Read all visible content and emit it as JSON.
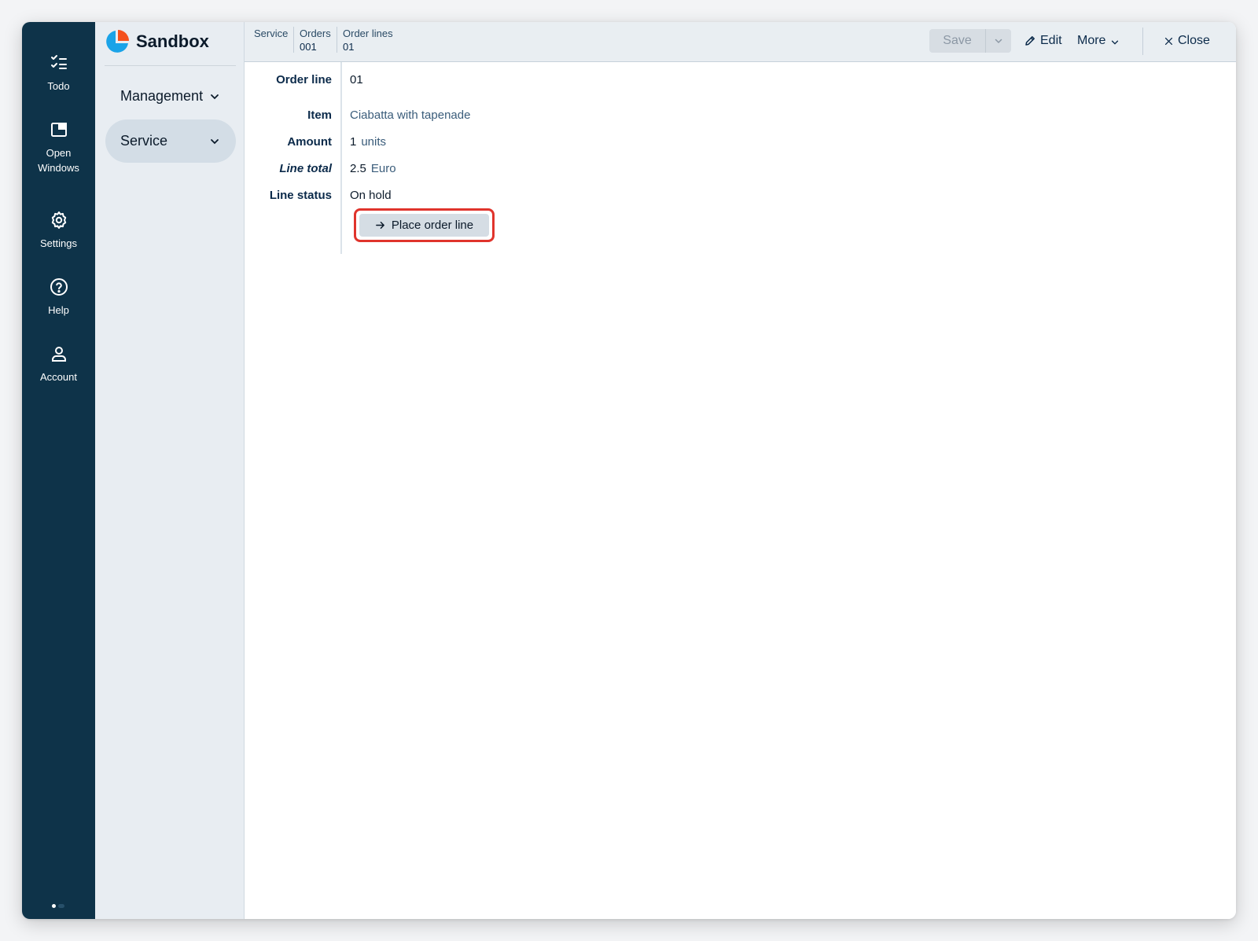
{
  "rail": {
    "items": [
      {
        "label": "Todo",
        "icon": "todo-checklist-icon"
      },
      {
        "label": "Open\nWindows",
        "icon": "open-windows-icon"
      },
      {
        "label": "Settings",
        "icon": "gear-icon"
      },
      {
        "label": "Help",
        "icon": "help-circle-icon"
      },
      {
        "label": "Account",
        "icon": "user-icon"
      }
    ]
  },
  "nav": {
    "brand": "Sandbox",
    "items": [
      {
        "label": "Management"
      },
      {
        "label": "Service"
      }
    ]
  },
  "breadcrumb": [
    {
      "label": "Service",
      "sub": ""
    },
    {
      "label": "Orders",
      "sub": "001"
    },
    {
      "label": "Order lines",
      "sub": "01"
    }
  ],
  "toolbar": {
    "save": "Save",
    "edit": "Edit",
    "more": "More",
    "close": "Close"
  },
  "form": {
    "order_line_label": "Order line",
    "order_line_value": "01",
    "item_label": "Item",
    "item_value": "Ciabatta with tapenade",
    "amount_label": "Amount",
    "amount_value": "1",
    "amount_unit": "units",
    "line_total_label": "Line total",
    "line_total_value": "2.5",
    "line_total_unit": "Euro",
    "line_status_label": "Line status",
    "line_status_value": "On hold",
    "action_label": "Place order line"
  },
  "colors": {
    "rail_bg": "#0e3349",
    "nav_bg": "#e8edf2",
    "accent_blue": "#1aa3e8",
    "accent_orange": "#f4511e",
    "highlight_red": "#e0342c"
  }
}
